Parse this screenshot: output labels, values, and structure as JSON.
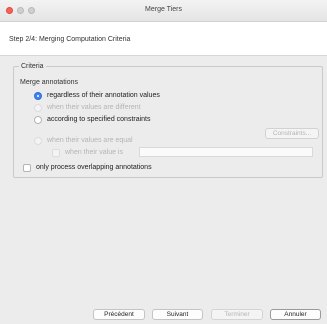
{
  "window": {
    "title": "Merge Tiers"
  },
  "step": {
    "title": "Step 2/4: Merging Computation Criteria"
  },
  "criteria": {
    "legend": "Criteria",
    "merge_label": "Merge annotations",
    "opt_regardless": "regardless of their annotation values",
    "opt_different": "when their values are different",
    "opt_constraints": "according to specified constraints",
    "constraints_button": "Constraints...",
    "opt_equal": "when their values are equal",
    "opt_value_is": "when their value is",
    "value_input": "",
    "only_overlapping": "only process overlapping annotations"
  },
  "footer": {
    "previous": "Précédent",
    "next": "Suivant",
    "finish": "Terminer",
    "cancel": "Annuler"
  }
}
